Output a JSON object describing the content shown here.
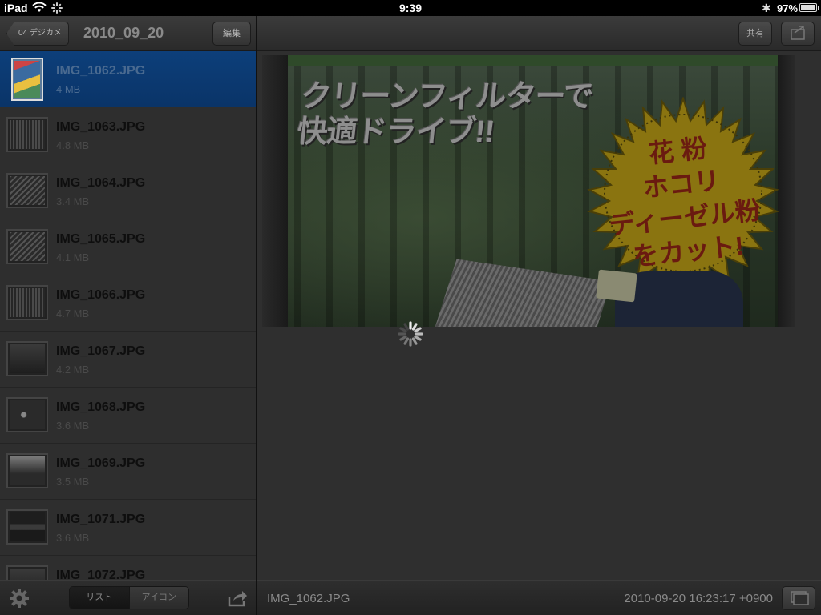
{
  "status_bar": {
    "device": "iPad",
    "time": "9:39",
    "battery": "97%"
  },
  "left_nav": {
    "back_label": "04 デジカメ",
    "title": "2010_09_20",
    "edit_label": "編集"
  },
  "files": [
    {
      "name": "IMG_1062.JPG",
      "size": "4 MB",
      "selected": true
    },
    {
      "name": "IMG_1063.JPG",
      "size": "4.8 MB"
    },
    {
      "name": "IMG_1064.JPG",
      "size": "3.4 MB"
    },
    {
      "name": "IMG_1065.JPG",
      "size": "4.1 MB"
    },
    {
      "name": "IMG_1066.JPG",
      "size": "4.7 MB"
    },
    {
      "name": "IMG_1067.JPG",
      "size": "4.2 MB"
    },
    {
      "name": "IMG_1068.JPG",
      "size": "3.6 MB"
    },
    {
      "name": "IMG_1069.JPG",
      "size": "3.5 MB"
    },
    {
      "name": "IMG_1071.JPG",
      "size": "3.6 MB"
    },
    {
      "name": "IMG_1072.JPG",
      "size": ""
    }
  ],
  "left_toolbar": {
    "list_label": "リスト",
    "icon_label": "アイコン"
  },
  "right_nav": {
    "share_label": "共有"
  },
  "photo": {
    "headline_line1": "クリーンフィルターで",
    "headline_line2": "快適ドライブ!!",
    "badge_line1": "花 粉",
    "badge_line2": "ホコリ",
    "badge_line3": "ディーゼル粉",
    "badge_line4": "をカット!"
  },
  "right_toolbar": {
    "filename": "IMG_1062.JPG",
    "datetime": "2010-09-20 16:23:17 +0900"
  },
  "colors": {
    "selection": "#0d3f7a",
    "badge": "#8a7410"
  }
}
